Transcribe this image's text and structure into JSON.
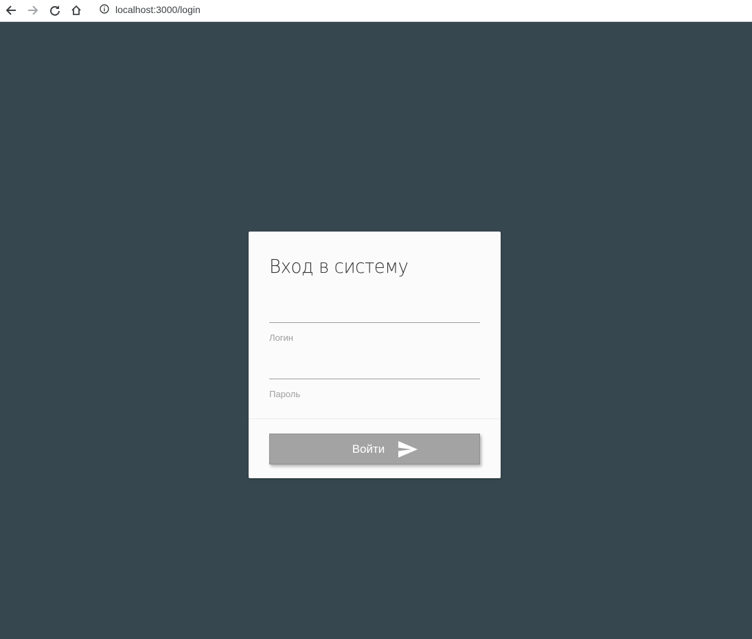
{
  "browser": {
    "url": "localhost:3000/login",
    "icons": {
      "back": "arrow-left-icon",
      "forward": "arrow-right-icon",
      "reload": "reload-icon",
      "home": "home-icon",
      "info": "info-icon"
    }
  },
  "colors": {
    "page_background": "#37474f",
    "card_background": "#fbfbfb",
    "button_background": "#a3a3a3",
    "label_color": "#9e9e9e"
  },
  "login_form": {
    "title": "Вход в систему",
    "login_field": {
      "label": "Логин",
      "value": ""
    },
    "password_field": {
      "label": "Пароль",
      "value": ""
    },
    "submit_label": "Войти",
    "submit_icon": "send-icon"
  }
}
